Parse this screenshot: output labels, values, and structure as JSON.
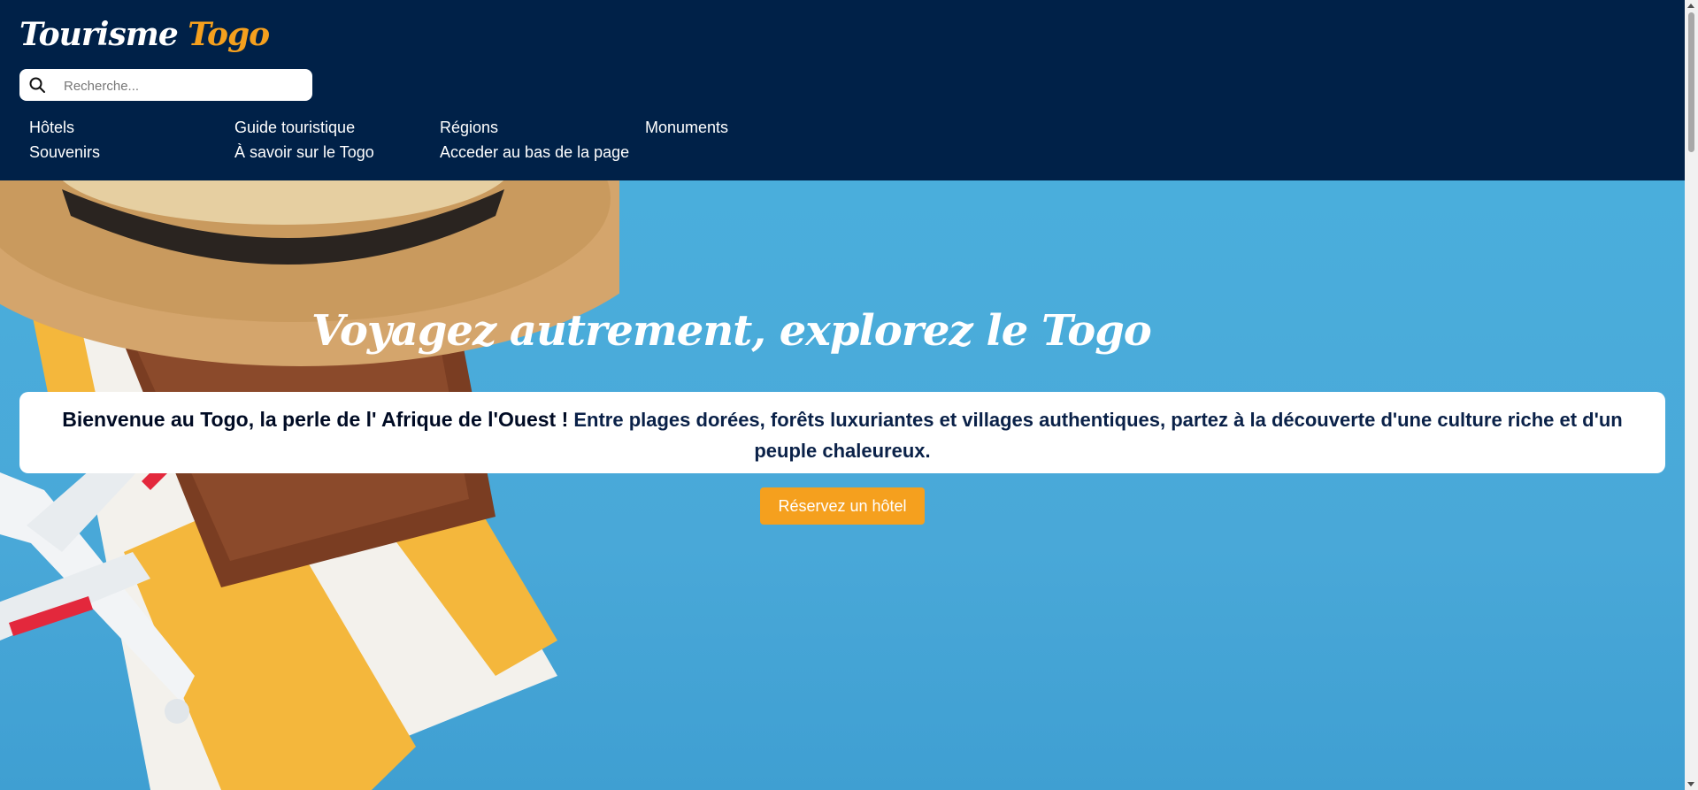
{
  "header": {
    "logo_main": "Tourisme",
    "logo_accent": "Togo",
    "search": {
      "placeholder": "Recherche...",
      "icon": "search-icon"
    },
    "nav": [
      {
        "label": "Hôtels"
      },
      {
        "label": "Guide touristique"
      },
      {
        "label": "Régions"
      },
      {
        "label": "Monuments"
      },
      {
        "label": "Souvenirs"
      },
      {
        "label": "À savoir sur le Togo"
      },
      {
        "label": "Acceder au bas de la page"
      }
    ]
  },
  "hero": {
    "title": "Voyagez autrement, explorez le Togo",
    "welcome_strong": "Bienvenue au Togo, la perle de l' Afrique de l'Ouest !",
    "welcome_text": " Entre plages dorées, forêts luxuriantes et villages authentiques, partez à la découverte d'une culture riche et d'un peuple chaleureux.",
    "cta_label": "Réservez un hôtel"
  },
  "colors": {
    "header_bg": "#002148",
    "accent": "#f5a01e",
    "hero_bg": "#4aa9d8"
  }
}
